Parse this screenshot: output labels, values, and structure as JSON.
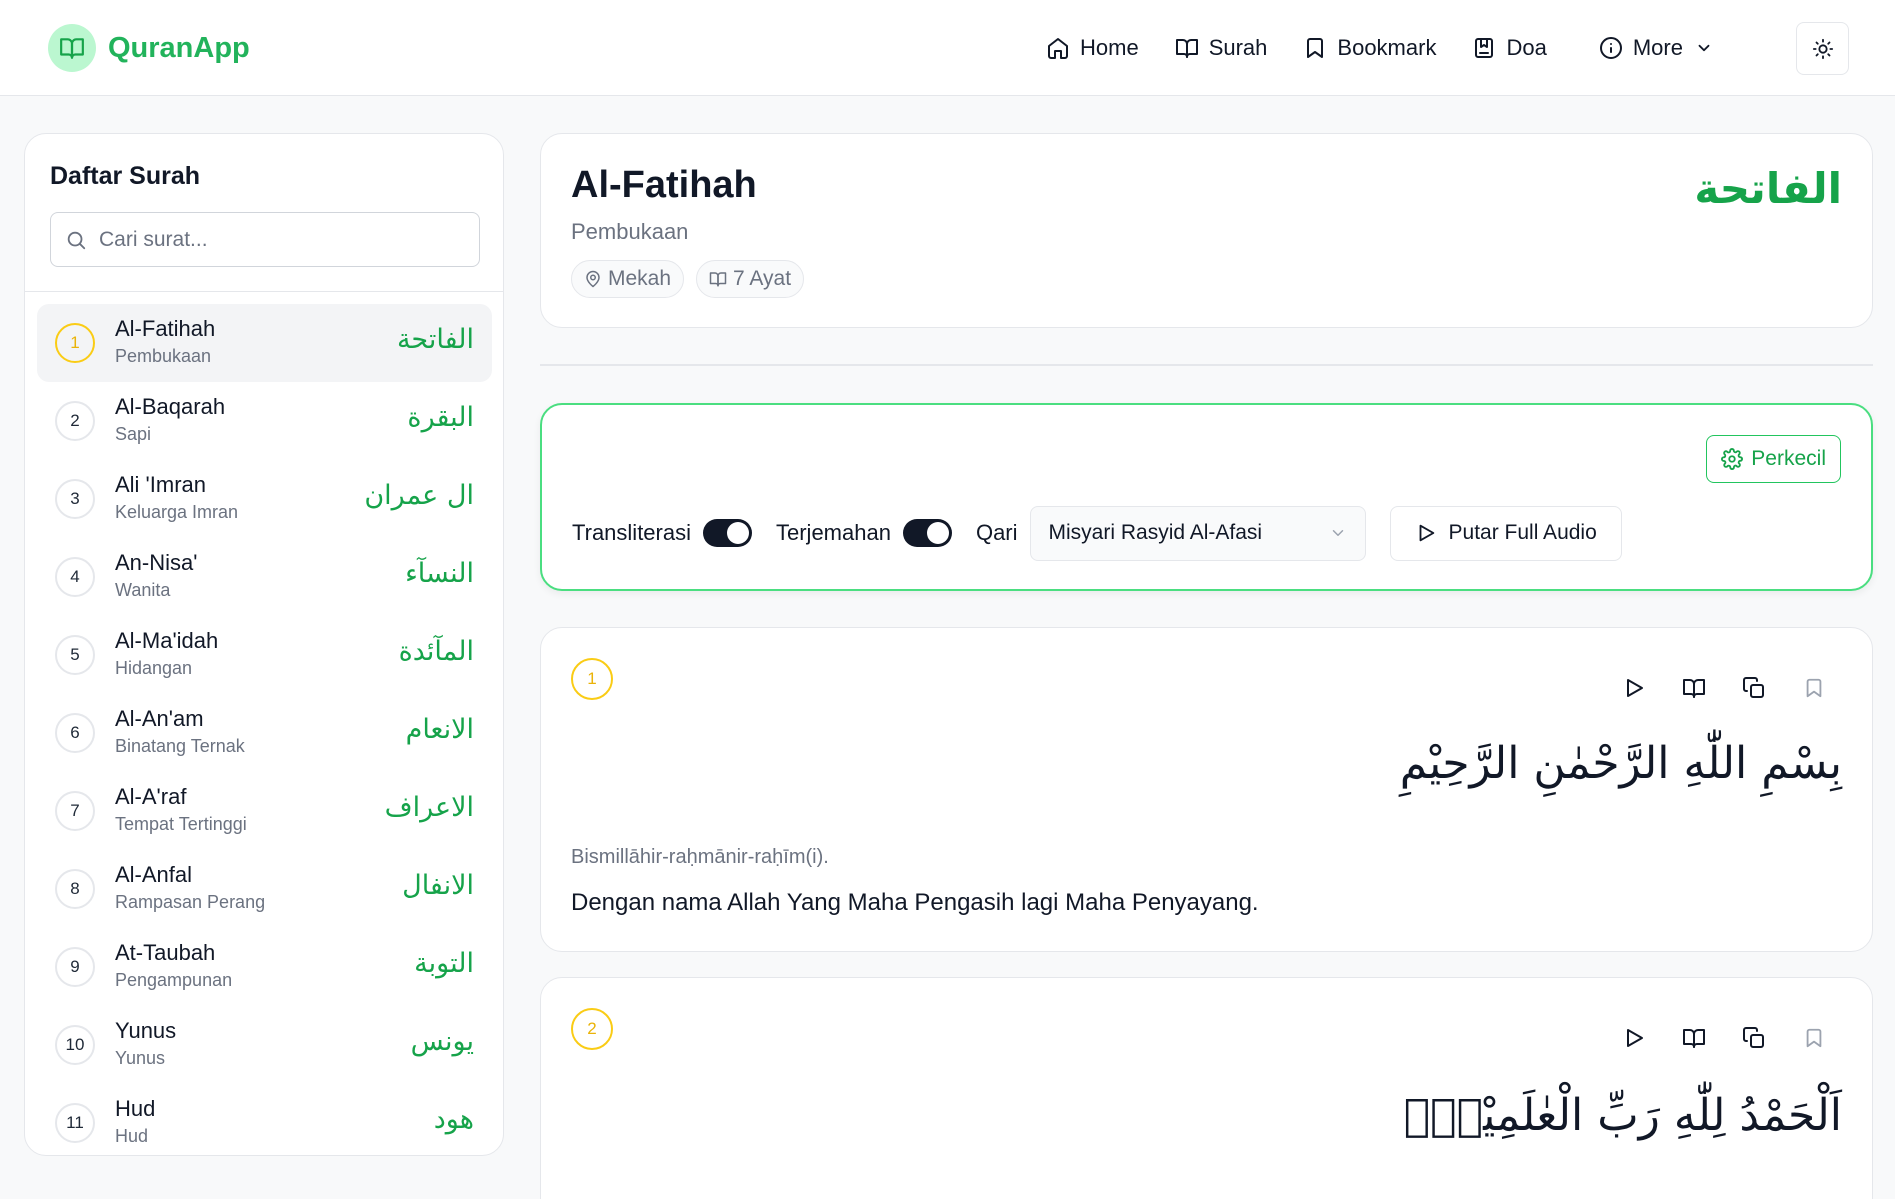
{
  "app": {
    "name": "QuranApp"
  },
  "nav": {
    "home": "Home",
    "surah": "Surah",
    "bookmark": "Bookmark",
    "doa": "Doa",
    "more": "More"
  },
  "sidebar": {
    "title": "Daftar Surah",
    "search_placeholder": "Cari surat...",
    "items": [
      {
        "num": "1",
        "latin": "Al-Fatihah",
        "meaning": "Pembukaan",
        "arabic": "الفاتحة"
      },
      {
        "num": "2",
        "latin": "Al-Baqarah",
        "meaning": "Sapi",
        "arabic": "البقرة"
      },
      {
        "num": "3",
        "latin": "Ali 'Imran",
        "meaning": "Keluarga Imran",
        "arabic": "ال عمران"
      },
      {
        "num": "4",
        "latin": "An-Nisa'",
        "meaning": "Wanita",
        "arabic": "النسآء"
      },
      {
        "num": "5",
        "latin": "Al-Ma'idah",
        "meaning": "Hidangan",
        "arabic": "المآئدة"
      },
      {
        "num": "6",
        "latin": "Al-An'am",
        "meaning": "Binatang Ternak",
        "arabic": "الانعام"
      },
      {
        "num": "7",
        "latin": "Al-A'raf",
        "meaning": "Tempat Tertinggi",
        "arabic": "الاعراف"
      },
      {
        "num": "8",
        "latin": "Al-Anfal",
        "meaning": "Rampasan Perang",
        "arabic": "الانفال"
      },
      {
        "num": "9",
        "latin": "At-Taubah",
        "meaning": "Pengampunan",
        "arabic": "التوبة"
      },
      {
        "num": "10",
        "latin": "Yunus",
        "meaning": "Yunus",
        "arabic": "يونس"
      },
      {
        "num": "11",
        "latin": "Hud",
        "meaning": "Hud",
        "arabic": "هود"
      }
    ]
  },
  "surah": {
    "title": "Al-Fatihah",
    "subtitle": "Pembukaan",
    "arabic": "الفاتحة",
    "place": "Mekah",
    "ayat": "7 Ayat"
  },
  "settings": {
    "shrink_label": "Perkecil",
    "transliterasi_label": "Transliterasi",
    "terjemahan_label": "Terjemahan",
    "qari_label": "Qari",
    "qari_value": "Misyari Rasyid Al-Afasi",
    "play_full_label": "Putar Full Audio"
  },
  "verses": [
    {
      "num": "1",
      "arabic": "بِسْمِ اللّٰهِ الرَّحْمٰنِ الرَّحِيْمِ",
      "translit": "Bismillāhir-raḥmānir-raḥīm(i).",
      "translation": "Dengan nama Allah Yang Maha Pengasih lagi Maha Penyayang."
    },
    {
      "num": "2",
      "arabic": "اَلْحَمْدُ لِلّٰهِ رَبِّ الْعٰلَمِيْنَۙ"
    }
  ],
  "colors": {
    "accent": "#22b35b",
    "accent_light": "#bbf7d0",
    "badge_yellow": "#facc15"
  }
}
